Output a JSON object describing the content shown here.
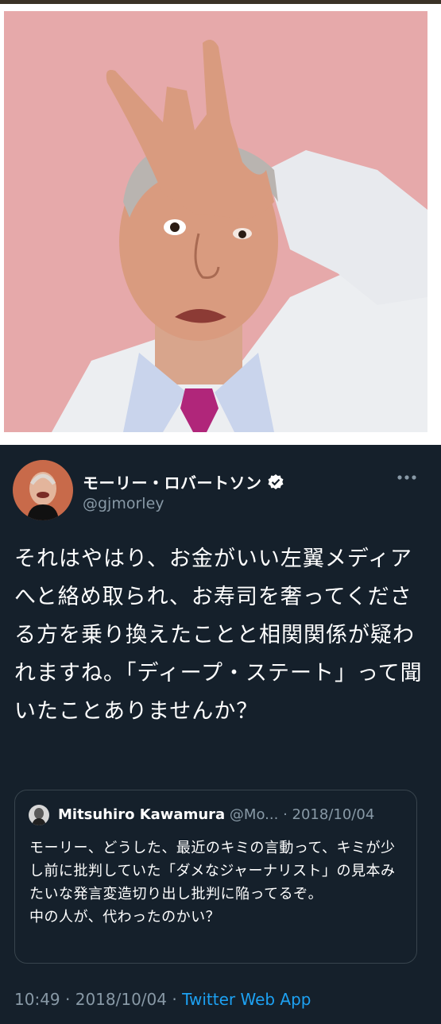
{
  "photo": {
    "background": "#e6a9aa"
  },
  "tweet": {
    "display_name": "モーリー・ロバートソン",
    "handle": "@gjmorley",
    "verified_icon": "verified-badge-icon",
    "more_icon": "more-options-icon",
    "text": "それはやはり、お金がいい左翼メディアへと絡め取られ、お寿司を奢ってくださる方を乗り換えたことと相関関係が疑われますね。「ディープ・ステート」って聞いたことありませんか？",
    "time": "10:49",
    "separator": "·",
    "date": "2018/10/04",
    "app": "Twitter Web App"
  },
  "quote": {
    "name": "Mitsuhiro Kawamura",
    "handle": "@Mo...",
    "separator": "·",
    "date": "2018/10/04",
    "text": "モーリー、どうした、最近のキミの言動って、キミが少し前に批判していた「ダメなジャーナリスト」の見本みたいな発言変造切り出し批判に陥ってるぞ。\n中の人が、代わったのかい？"
  },
  "colors": {
    "tweet_bg": "#15202b",
    "secondary_text": "#8899a6",
    "link": "#1da1f2",
    "border": "#38444d"
  }
}
